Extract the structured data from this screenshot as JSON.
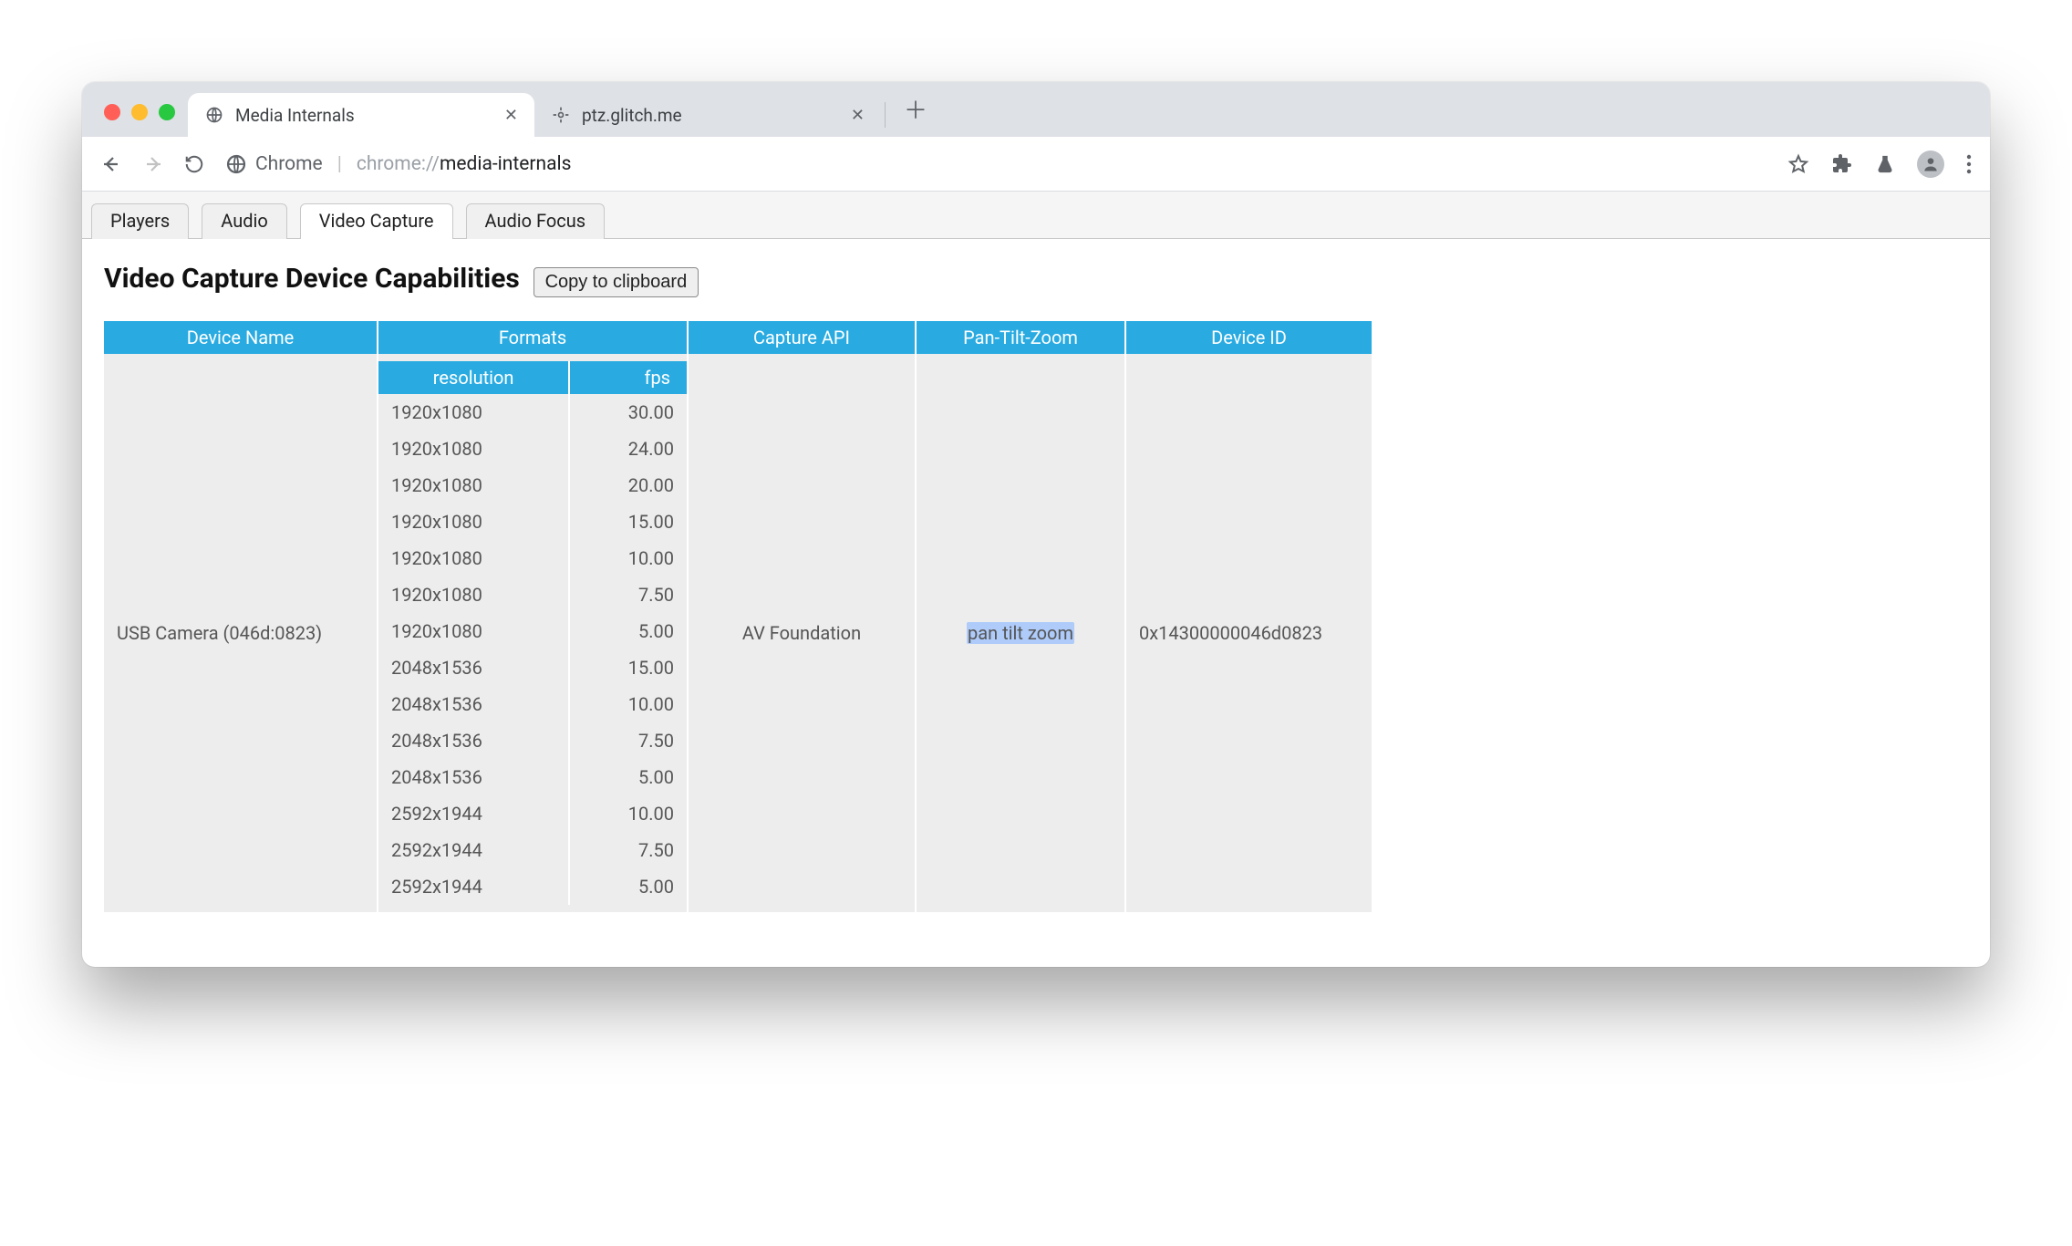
{
  "browser": {
    "tabs": [
      {
        "title": "Media Internals",
        "active": true,
        "favicon": "globe"
      },
      {
        "title": "ptz.glitch.me",
        "active": false,
        "favicon": "crosshair"
      }
    ],
    "address": {
      "origin_label": "Chrome",
      "path_prefix": "chrome://",
      "path": "media-internals"
    }
  },
  "page": {
    "tabs": [
      {
        "label": "Players",
        "active": false
      },
      {
        "label": "Audio",
        "active": false
      },
      {
        "label": "Video Capture",
        "active": true
      },
      {
        "label": "Audio Focus",
        "active": false
      }
    ],
    "title": "Video Capture Device Capabilities",
    "copy_button": "Copy to clipboard",
    "table": {
      "columns": [
        "Device Name",
        "Formats",
        "Capture API",
        "Pan-Tilt-Zoom",
        "Device ID"
      ],
      "format_headers": {
        "res": "resolution",
        "fps": "fps"
      },
      "rows": [
        {
          "device_name": "USB Camera (046d:0823)",
          "capture_api": "AV Foundation",
          "ptz": "pan tilt zoom",
          "device_id": "0x14300000046d0823",
          "formats": [
            {
              "res": "1920x1080",
              "fps": "30.00"
            },
            {
              "res": "1920x1080",
              "fps": "24.00"
            },
            {
              "res": "1920x1080",
              "fps": "20.00"
            },
            {
              "res": "1920x1080",
              "fps": "15.00"
            },
            {
              "res": "1920x1080",
              "fps": "10.00"
            },
            {
              "res": "1920x1080",
              "fps": "7.50"
            },
            {
              "res": "1920x1080",
              "fps": "5.00"
            },
            {
              "res": "2048x1536",
              "fps": "15.00"
            },
            {
              "res": "2048x1536",
              "fps": "10.00"
            },
            {
              "res": "2048x1536",
              "fps": "7.50"
            },
            {
              "res": "2048x1536",
              "fps": "5.00"
            },
            {
              "res": "2592x1944",
              "fps": "10.00"
            },
            {
              "res": "2592x1944",
              "fps": "7.50"
            },
            {
              "res": "2592x1944",
              "fps": "5.00"
            }
          ]
        }
      ]
    }
  }
}
